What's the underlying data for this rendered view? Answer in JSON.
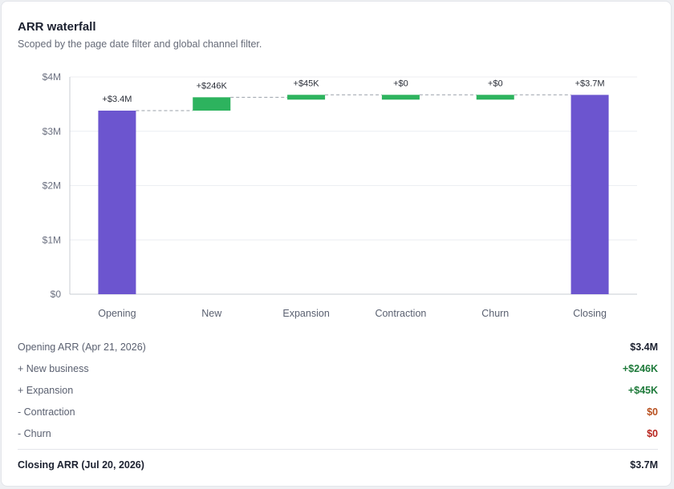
{
  "card": {
    "title": "ARR waterfall",
    "subtitle": "Scoped by the page date filter and global channel filter."
  },
  "chart_data": {
    "type": "bar",
    "variant": "waterfall",
    "categories": [
      "Opening",
      "New",
      "Expansion",
      "Contraction",
      "Churn",
      "Closing"
    ],
    "values": [
      3.38,
      0.246,
      0.045,
      0,
      0,
      3.67
    ],
    "units": "millions USD",
    "bar_kinds": [
      "total",
      "delta",
      "delta",
      "delta",
      "delta",
      "total"
    ],
    "data_labels": [
      "+$3.4M",
      "+$246K",
      "+$45K",
      "+$0",
      "+$0",
      "+$3.7M"
    ],
    "y_ticks": [
      "$0",
      "$1M",
      "$2M",
      "$3M",
      "$4M"
    ],
    "ylim": [
      0,
      4
    ],
    "grid": true,
    "colors": {
      "total": "#6c55cf",
      "delta": "#2db35e",
      "connector": "#9aa0aa"
    }
  },
  "summary": {
    "rows": [
      {
        "label": "Opening ARR (Apr 21, 2026)",
        "value": "$3.4M",
        "tone": "default"
      },
      {
        "label": "+ New business",
        "value": "+$246K",
        "tone": "pos"
      },
      {
        "label": "+ Expansion",
        "value": "+$45K",
        "tone": "pos"
      },
      {
        "label": "- Contraction",
        "value": "$0",
        "tone": "neg"
      },
      {
        "label": "- Churn",
        "value": "$0",
        "tone": "neg2"
      }
    ],
    "closing": {
      "label": "Closing ARR (Jul 20, 2026)",
      "value": "$3.7M"
    }
  }
}
